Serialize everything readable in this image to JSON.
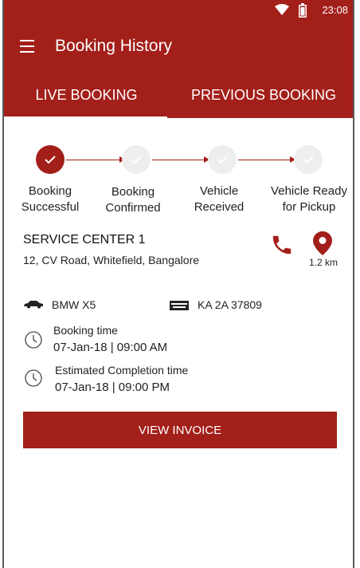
{
  "status_bar": {
    "time": "23:08",
    "wifi_icon": "wifi-icon",
    "battery_icon": "battery-icon"
  },
  "app_bar": {
    "menu_icon": "hamburger-menu-icon",
    "title": "Booking History"
  },
  "tabs": [
    {
      "label": "LIVE BOOKING",
      "active": true
    },
    {
      "label": "PREVIOUS BOOKING",
      "active": false
    }
  ],
  "progress": {
    "steps": [
      {
        "line1": "Booking",
        "line2": "Successful",
        "done": true
      },
      {
        "line1": "Booking",
        "line2": "Confirmed",
        "done": false
      },
      {
        "line1": "Vehicle",
        "line2": "Received",
        "done": false
      },
      {
        "line1": "Vehicle Ready",
        "line2": "for Pickup",
        "done": false
      }
    ]
  },
  "service_center": {
    "name": "SERVICE CENTER 1",
    "address": "12, CV Road, Whitefield, Bangalore",
    "distance": "1.2 km",
    "call_icon": "phone-icon",
    "location_icon": "map-pin-icon"
  },
  "vehicle": {
    "model": "BMW X5",
    "plate": "KA 2A 37809",
    "car_icon": "car-icon",
    "plate_icon": "license-plate-icon"
  },
  "booking_time": {
    "label": "Booking time",
    "value": "07-Jan-18 | 09:00 AM"
  },
  "completion_time": {
    "label": "Estimated Completion time",
    "value": "07-Jan-18 | 09:00 PM"
  },
  "actions": {
    "view_invoice": "VIEW INVOICE"
  },
  "colors": {
    "primary": "#a31f1a",
    "step_inactive": "#eeeeee"
  }
}
